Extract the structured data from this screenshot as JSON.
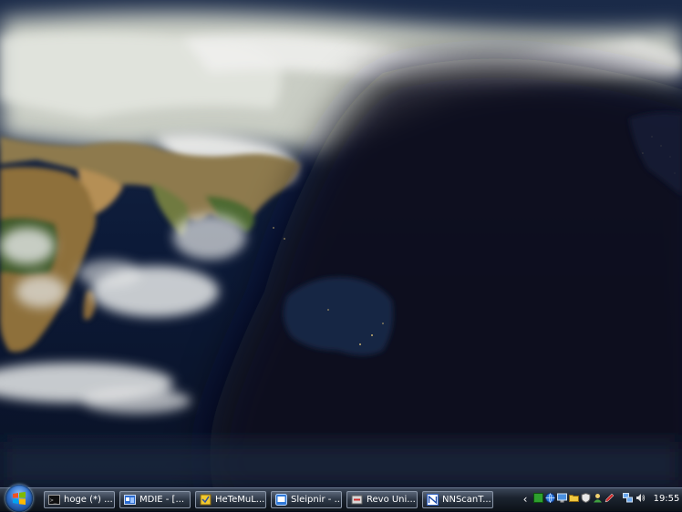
{
  "taskbar": {
    "buttons": [
      {
        "label": "hoge (*) ...",
        "icon": "command-prompt-icon"
      },
      {
        "label": "MDIE - [...",
        "icon": "mdie-icon"
      },
      {
        "label": "HeTeMuL...",
        "icon": "hetemul-icon"
      },
      {
        "label": "Sleipnir - ...",
        "icon": "sleipnir-browser-icon"
      },
      {
        "label": "Revo Uni...",
        "icon": "revo-uninstaller-icon"
      },
      {
        "label": "NNScanT...",
        "icon": "nnscan-icon"
      }
    ],
    "tray_expand": "‹",
    "tray_icons": [
      "green-box-icon",
      "network-globe-icon",
      "monitor-icon",
      "folder-icon",
      "shield-icon",
      "user-icon",
      "pen-icon",
      "network-connection-icon",
      "speaker-icon"
    ],
    "clock": "19:55"
  },
  "colors": {
    "taskbar": "#1c2430",
    "ocean": "#0a1830",
    "land": "#8a6e3e",
    "cloud": "#d8dcdc"
  }
}
